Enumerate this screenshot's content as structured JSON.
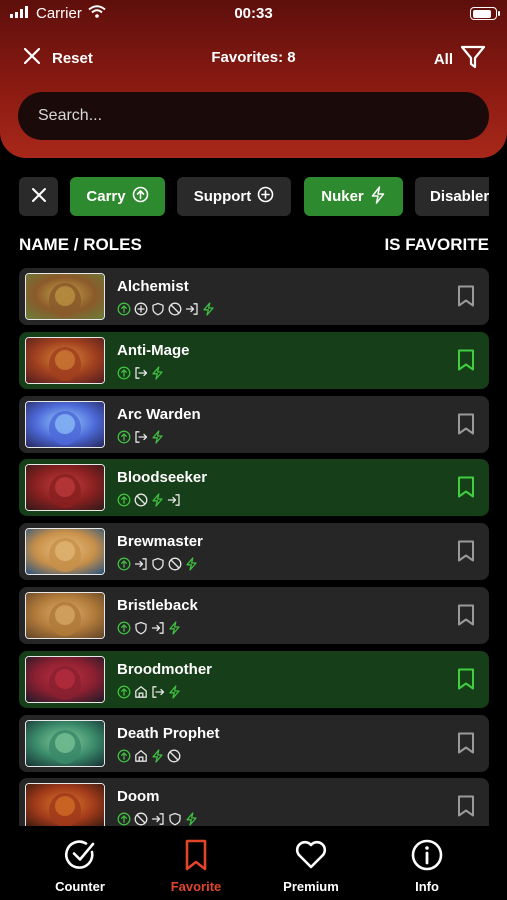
{
  "status_bar": {
    "carrier": "Carrier",
    "time": "00:33",
    "battery_level": 0.9
  },
  "header": {
    "reset_label": "Reset",
    "favorites_label": "Favorites: 8",
    "filter_label": "All"
  },
  "search": {
    "placeholder": "Search...",
    "value": ""
  },
  "filter_chips": [
    {
      "label": "",
      "icon": "close-icon",
      "active": false
    },
    {
      "label": "Carry",
      "icon": "arrow-up-circle-icon",
      "active": true
    },
    {
      "label": "Support",
      "icon": "plus-circle-icon",
      "active": false
    },
    {
      "label": "Nuker",
      "icon": "lightning-icon",
      "active": true
    },
    {
      "label": "Disabler",
      "icon": "",
      "active": false
    }
  ],
  "list_header": {
    "name_label": "NAME / ROLES",
    "favorite_label": "IS FAVORITE"
  },
  "heroes": [
    {
      "name": "Alchemist",
      "favorite": false,
      "roles": [
        "carry",
        "support",
        "durable",
        "disabler",
        "initiator",
        "nuker"
      ]
    },
    {
      "name": "Anti-Mage",
      "favorite": true,
      "roles": [
        "carry",
        "escape",
        "nuker"
      ]
    },
    {
      "name": "Arc Warden",
      "favorite": false,
      "roles": [
        "carry",
        "escape",
        "nuker"
      ]
    },
    {
      "name": "Bloodseeker",
      "favorite": true,
      "roles": [
        "carry",
        "disabler",
        "nuker",
        "initiator"
      ]
    },
    {
      "name": "Brewmaster",
      "favorite": false,
      "roles": [
        "carry",
        "initiator",
        "durable",
        "disabler",
        "nuker"
      ]
    },
    {
      "name": "Bristleback",
      "favorite": false,
      "roles": [
        "carry",
        "durable",
        "initiator",
        "nuker"
      ]
    },
    {
      "name": "Broodmother",
      "favorite": true,
      "roles": [
        "carry",
        "pusher",
        "escape",
        "nuker"
      ]
    },
    {
      "name": "Death Prophet",
      "favorite": false,
      "roles": [
        "carry",
        "pusher",
        "nuker",
        "disabler"
      ]
    },
    {
      "name": "Doom",
      "favorite": false,
      "roles": [
        "carry",
        "disabler",
        "initiator",
        "durable",
        "nuker"
      ]
    }
  ],
  "tabbar": [
    {
      "label": "Counter",
      "icon": "check-circle-icon",
      "active": false
    },
    {
      "label": "Favorite",
      "icon": "bookmark-icon",
      "active": true
    },
    {
      "label": "Premium",
      "icon": "heart-icon",
      "active": false
    },
    {
      "label": "Info",
      "icon": "info-icon",
      "active": false
    }
  ],
  "colors": {
    "header_top": "#5e0f0c",
    "header_bottom": "#a8281a",
    "accent_green": "#2e8a2e",
    "favorite_row": "#163e18",
    "role_icon_green": "#3fbf3f",
    "tab_active": "#e0452a"
  }
}
